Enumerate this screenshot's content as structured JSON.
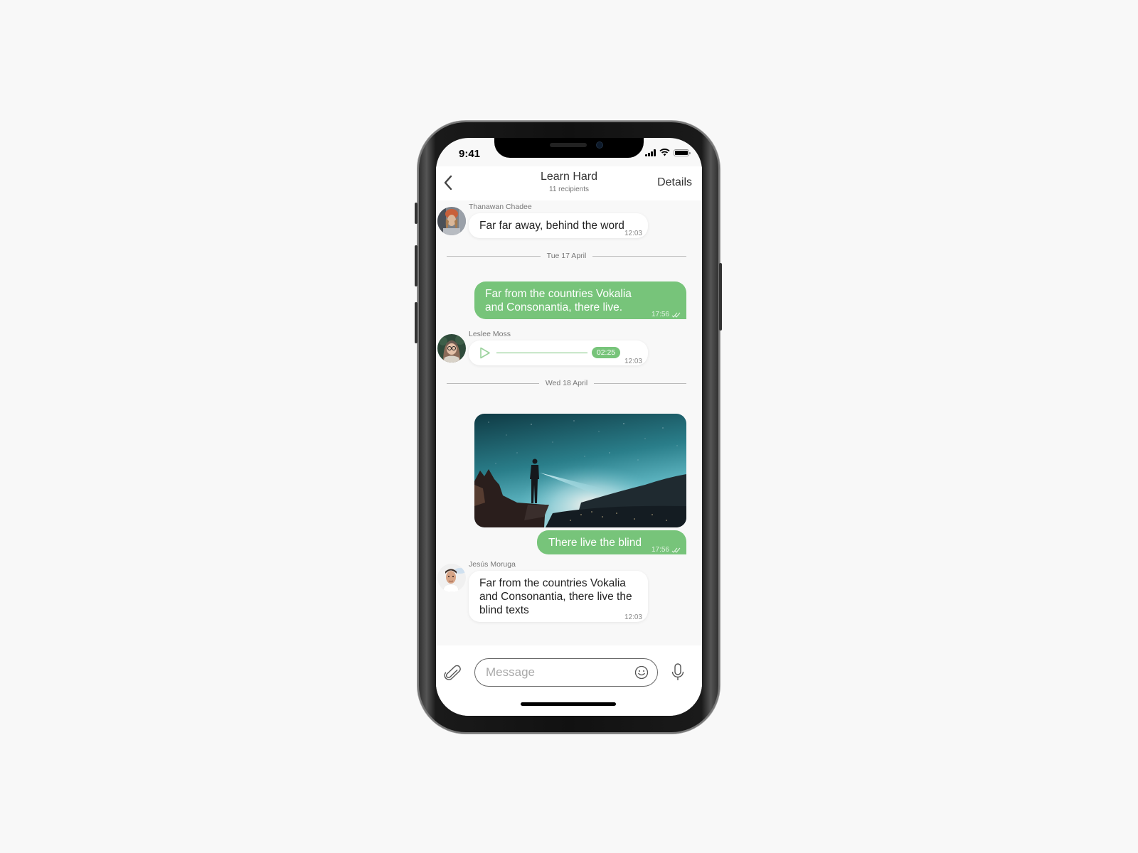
{
  "status_bar": {
    "time": "9:41"
  },
  "header": {
    "back_icon": "chevron-left-icon",
    "title": "Learn Hard",
    "subtitle": "11 recipients",
    "details_label": "Details"
  },
  "messages": [
    {
      "type": "incoming-text",
      "sender": "Thanawan Chadee",
      "text": "Far far away, behind the word",
      "time": "12:03"
    },
    {
      "type": "date-separator",
      "label": "Tue 17 April"
    },
    {
      "type": "outgoing-text",
      "text_lines": [
        "Far from the countries Vokalia",
        "and Consonantia, there live."
      ],
      "time": "17:56",
      "status_icon": "double-check-icon"
    },
    {
      "type": "incoming-audio",
      "sender": "Leslee Moss",
      "duration": "02:25",
      "progress": 0,
      "time": "12:03",
      "play_icon": "play-icon"
    },
    {
      "type": "date-separator",
      "label": "Wed 18 April"
    },
    {
      "type": "outgoing-image",
      "image_description": "Person with headlamp standing on a cliff under a starry night sky"
    },
    {
      "type": "outgoing-text",
      "text": "There live the blind",
      "time": "17:56",
      "status_icon": "double-check-icon"
    },
    {
      "type": "incoming-text",
      "sender": "Jesús Moruga",
      "text_lines": [
        "Far from the countries Vokalia",
        "and Consonantia, there live the",
        "blind texts"
      ],
      "time": "12:03"
    }
  ],
  "composer": {
    "attach_icon": "paperclip-icon",
    "placeholder": "Message",
    "value": "",
    "emoji_icon": "smiley-icon",
    "mic_icon": "microphone-icon"
  },
  "colors": {
    "accent_green": "#77c47a",
    "background": "#f8f8f8",
    "bubble_incoming": "#ffffff"
  }
}
